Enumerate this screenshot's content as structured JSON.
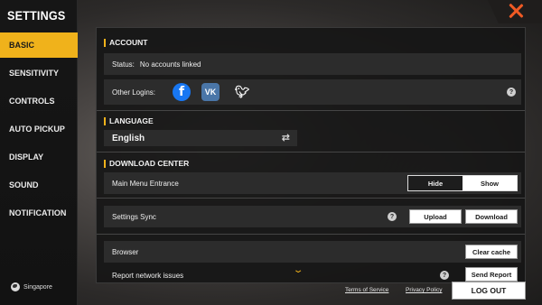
{
  "sidebar": {
    "title": "SETTINGS",
    "items": [
      {
        "label": "BASIC",
        "active": true
      },
      {
        "label": "SENSITIVITY",
        "active": false
      },
      {
        "label": "CONTROLS",
        "active": false
      },
      {
        "label": "AUTO PICKUP",
        "active": false
      },
      {
        "label": "DISPLAY",
        "active": false
      },
      {
        "label": "SOUND",
        "active": false
      },
      {
        "label": "NOTIFICATION",
        "active": false
      }
    ],
    "region": "Singapore"
  },
  "account": {
    "heading": "ACCOUNT",
    "status_label": "Status:",
    "status_value": "No accounts linked",
    "other_logins_label": "Other Logins:",
    "logins": [
      "facebook-icon",
      "vk-icon",
      "twitter-icon"
    ],
    "help": "?"
  },
  "language": {
    "heading": "LANGUAGE",
    "selected": "English"
  },
  "download_center": {
    "heading": "DOWNLOAD CENTER",
    "main_menu_label": "Main Menu Entrance",
    "options": [
      "Hide",
      "Show"
    ],
    "selected": "Show"
  },
  "settings_sync": {
    "label": "Settings Sync",
    "upload": "Upload",
    "download": "Download",
    "help": "?"
  },
  "browser": {
    "label": "Browser",
    "clear_cache": "Clear cache"
  },
  "report": {
    "label": "Report network issues",
    "send_report": "Send Report",
    "help": "?"
  },
  "footer": {
    "terms": "Terms of Service",
    "privacy": "Privacy Policy",
    "logout": "LOG OUT"
  },
  "colors": {
    "accent": "#f0b21b",
    "close": "#f05a24",
    "facebook": "#1877f2",
    "vk": "#4a76a8"
  }
}
